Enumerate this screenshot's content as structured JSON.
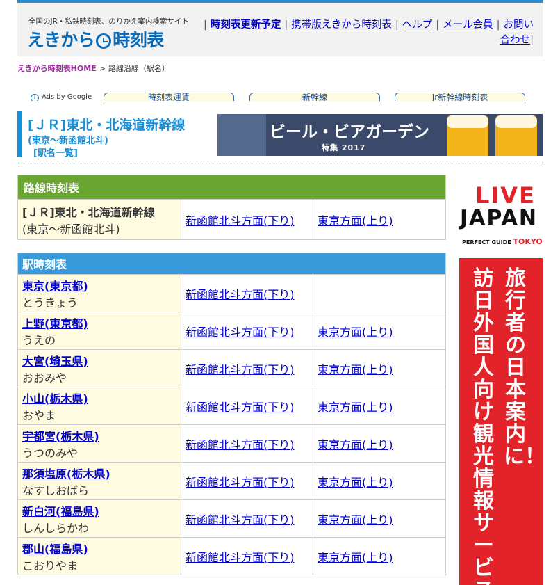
{
  "header": {
    "tagline": "全国のJR・私鉄時刻表、のりかえ案内検索サイト",
    "logo_left": "えきから",
    "logo_right": "時刻表",
    "nav": [
      {
        "label": "時刻表更新予定"
      },
      {
        "label": "携帯版えきから時刻表"
      },
      {
        "label": "ヘルプ"
      },
      {
        "label": "メール会員"
      },
      {
        "label": "お問い合わせ"
      }
    ]
  },
  "breadcrumb": {
    "home": "えきから時刻表HOME",
    "arrow": ">",
    "current": "路線沿線（駅名）"
  },
  "ads_row": {
    "label": "Ads by Google",
    "buttons": [
      "時刻表運賃",
      "新幹線",
      "Jr新幹線時刻表"
    ]
  },
  "page": {
    "title": "[ＪＲ]東北・北海道新幹線",
    "subtitle": "(東京～新函館北斗)",
    "station_list_link": "[駅名一覧]"
  },
  "banner": {
    "text": "ビール・ビアガーデン",
    "sub": "特集 2017"
  },
  "route_timetable": {
    "header": "路線時刻表",
    "route_name": "[ＪＲ]東北・北海道新幹線",
    "route_range": "(東京～新函館北斗)",
    "down_label": "新函館北斗方面(下り)",
    "up_label": "東京方面(上り)"
  },
  "station_timetable": {
    "header": "駅時刻表",
    "stations": [
      {
        "name": "東京(東京都)",
        "kana": "とうきょう",
        "down": "新函館北斗方面(下り)",
        "up": ""
      },
      {
        "name": "上野(東京都)",
        "kana": "うえの",
        "down": "新函館北斗方面(下り)",
        "up": "東京方面(上り)"
      },
      {
        "name": "大宮(埼玉県)",
        "kana": "おおみや",
        "down": "新函館北斗方面(下り)",
        "up": "東京方面(上り)"
      },
      {
        "name": "小山(栃木県)",
        "kana": "おやま",
        "down": "新函館北斗方面(下り)",
        "up": "東京方面(上り)"
      },
      {
        "name": "宇都宮(栃木県)",
        "kana": "うつのみや",
        "down": "新函館北斗方面(下り)",
        "up": "東京方面(上り)"
      },
      {
        "name": "那須塩原(栃木県)",
        "kana": "なすしおばら",
        "down": "新函館北斗方面(下り)",
        "up": "東京方面(上り)"
      },
      {
        "name": "新白河(福島県)",
        "kana": "しんしらかわ",
        "down": "新函館北斗方面(下り)",
        "up": "東京方面(上り)"
      },
      {
        "name": "郡山(福島県)",
        "kana": "こおりやま",
        "down": "新函館北斗方面(下り)",
        "up": "東京方面(上り)"
      }
    ]
  },
  "side_ads": {
    "live": "LIVE",
    "japan": "JAPAN",
    "guide": "PERFECT GUIDE",
    "tokyo": "TOKYO",
    "red_col1": "旅行者の日本案内に！",
    "red_col2": "訪日外国人向け観光情報サービス"
  }
}
